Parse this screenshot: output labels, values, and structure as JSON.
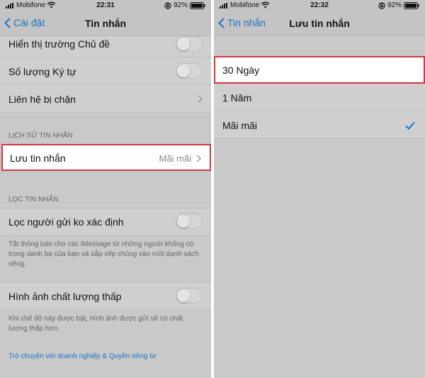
{
  "colors": {
    "accent": "#1a73c8",
    "highlight_border": "#d0393f"
  },
  "left": {
    "status": {
      "carrier": "Mobifone",
      "time": "22:31",
      "battery": "92%"
    },
    "nav": {
      "back_label": "Cài đặt",
      "title": "Tin nhắn"
    },
    "rows": {
      "topic": "Hiển thị trường Chủ đề",
      "char_count": "Số lượng Ký tự",
      "blocked": "Liên hệ bị chặn"
    },
    "history_section": {
      "header": "LỊCH SỬ TIN NHẮN",
      "keep_label": "Lưu tin nhắn",
      "keep_value": "Mãi mãi"
    },
    "filter_section": {
      "header": "LỌC TIN NHẮN",
      "filter_label": "Lọc người gửi ko xác định",
      "filter_footer": "Tắt thông báo cho các iMessage từ những người không có trong danh bạ của bạn và sắp xếp chúng vào một danh sách riêng."
    },
    "low_quality": {
      "label": "Hình ảnh chất lượng thấp",
      "footer": "Khi chế độ này được bật, hình ảnh được gửi sẽ có chất lượng thấp hơn."
    },
    "link": "Trò chuyện với doanh nghiệp & Quyền riêng tư"
  },
  "right": {
    "status": {
      "carrier": "Mobifone",
      "time": "22:32",
      "battery": "92%"
    },
    "nav": {
      "back_label": "Tin nhắn",
      "title": "Lưu tin nhắn"
    },
    "options": [
      "30 Ngày",
      "1 Năm",
      "Mãi mãi"
    ],
    "selected": "Mãi mãi"
  }
}
